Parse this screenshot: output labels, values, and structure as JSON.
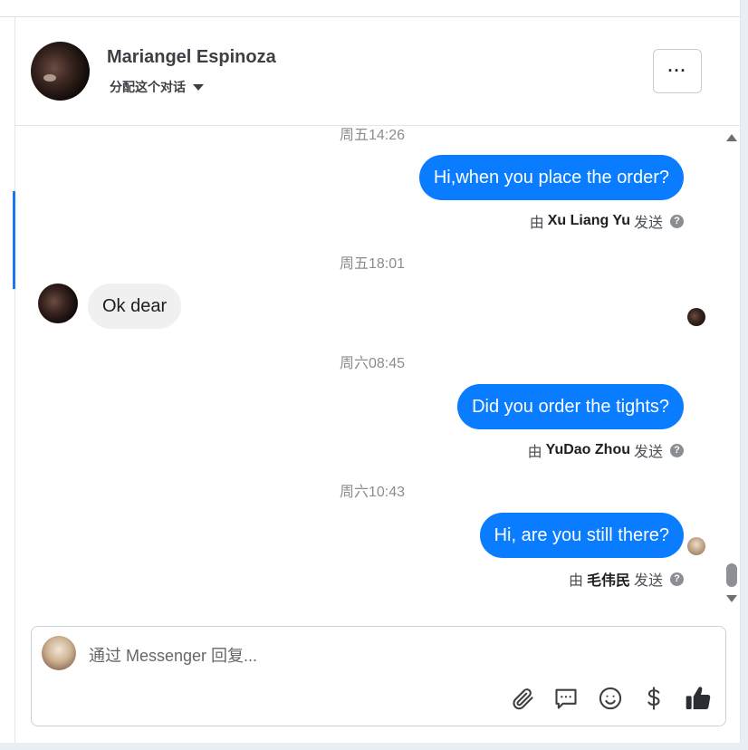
{
  "header": {
    "contact_name": "Mariangel Espinoza",
    "assign_label": "分配这个对话",
    "more_label": "···"
  },
  "messages": [
    {
      "timestamp": "周五14:26"
    },
    {
      "text": "Hi,when you place the order?",
      "direction": "out",
      "sent_prefix": "由",
      "sender": "Xu Liang Yu",
      "sent_suffix": "发送"
    },
    {
      "timestamp": "周五18:01"
    },
    {
      "text": "Ok dear",
      "direction": "in"
    },
    {
      "timestamp": "周六08:45"
    },
    {
      "text": "Did you order the tights?",
      "direction": "out",
      "sent_prefix": "由",
      "sender": "YuDao Zhou",
      "sent_suffix": "发送"
    },
    {
      "timestamp": "周六10:43"
    },
    {
      "text": "Hi, are you still there?",
      "direction": "out",
      "sent_prefix": "由",
      "sender": "毛伟民",
      "sent_suffix": "发送"
    }
  ],
  "composer": {
    "placeholder": "通过 Messenger 回复..."
  },
  "icons": [
    "chevron-down-icon",
    "more-icon",
    "help-icon",
    "attachment-icon",
    "saved-reply-icon",
    "emoji-icon",
    "payment-icon",
    "like-icon"
  ],
  "colors": {
    "outgoing_bubble": "#0a7cff",
    "incoming_bubble": "#f0f0f0",
    "accent": "#1877f2",
    "icon_dark": "#3c4043"
  }
}
